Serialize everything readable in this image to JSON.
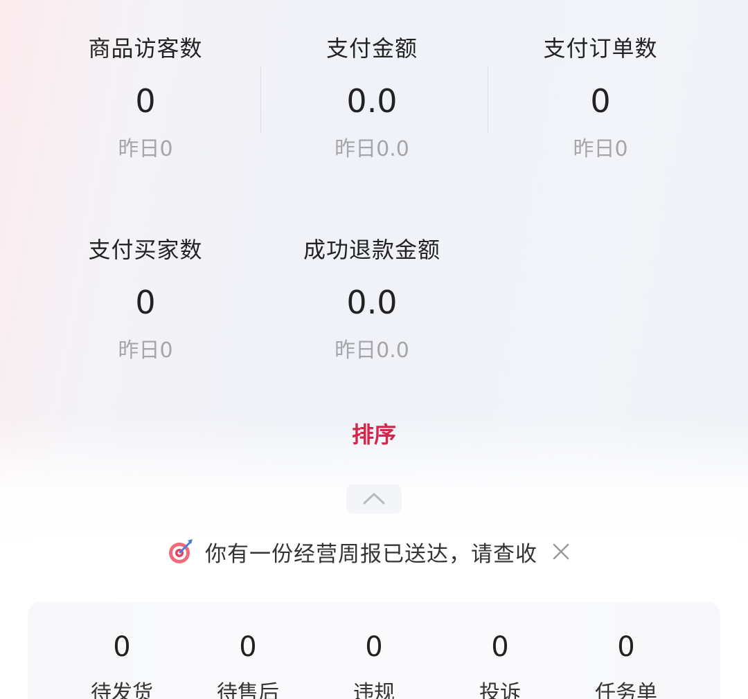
{
  "metrics": [
    {
      "label": "商品访客数",
      "value": "0",
      "prev": "昨日0"
    },
    {
      "label": "支付金额",
      "value": "0.0",
      "prev": "昨日0.0"
    },
    {
      "label": "支付订单数",
      "value": "0",
      "prev": "昨日0"
    },
    {
      "label": "支付买家数",
      "value": "0",
      "prev": "昨日0"
    },
    {
      "label": "成功退款金额",
      "value": "0.0",
      "prev": "昨日0.0"
    }
  ],
  "sort_label": "排序",
  "notice": {
    "text": "你有一份经营周报已送达，请查收",
    "icon": "target-icon"
  },
  "tasks": [
    {
      "num": "0",
      "label": "待发货"
    },
    {
      "num": "0",
      "label": "待售后"
    },
    {
      "num": "0",
      "label": "违规"
    },
    {
      "num": "0",
      "label": "投诉"
    },
    {
      "num": "0",
      "label": "任务单"
    }
  ],
  "colors": {
    "accent": "#d2274a",
    "muted": "#a6a6aa"
  }
}
